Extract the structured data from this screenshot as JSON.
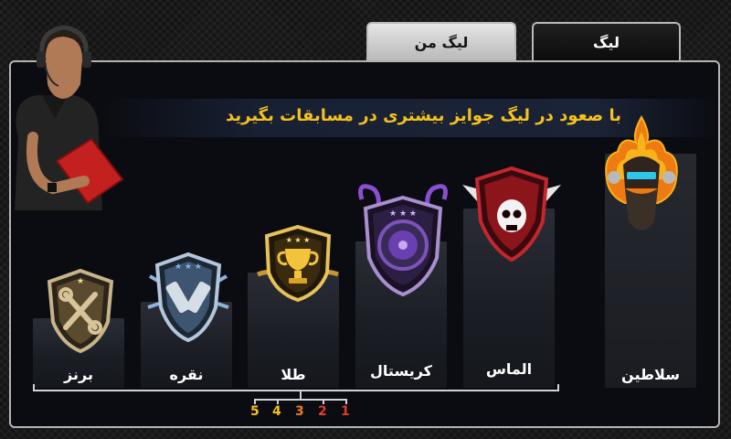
{
  "tabs": {
    "league": "لیگ",
    "my_league": "لیگ من"
  },
  "banner": {
    "text": "با صعود در لیگ جوایز بیشتری در مسابقات بگیرید"
  },
  "leagues": [
    {
      "name": "برنز",
      "icon": "wrench-badge-icon",
      "color": "#b89b6b"
    },
    {
      "name": "نقره",
      "icon": "spark-plugs-badge-icon",
      "color": "#9fb7cf"
    },
    {
      "name": "طلا",
      "icon": "trophy-badge-icon",
      "color": "#e6b43a"
    },
    {
      "name": "کریستال",
      "icon": "wheel-badge-icon",
      "color": "#8d5bc6"
    },
    {
      "name": "الماس",
      "icon": "skull-badge-icon",
      "color": "#c4202a"
    },
    {
      "name": "سلاطین",
      "icon": "flaming-biker-badge-icon",
      "color": "#f18a14"
    }
  ],
  "ranks": [
    "5",
    "4",
    "3",
    "2",
    "1"
  ],
  "rank_colors": [
    "#f6c21b",
    "#f6c21b",
    "#f07a1a",
    "#e23b2a",
    "#e23b2a"
  ]
}
